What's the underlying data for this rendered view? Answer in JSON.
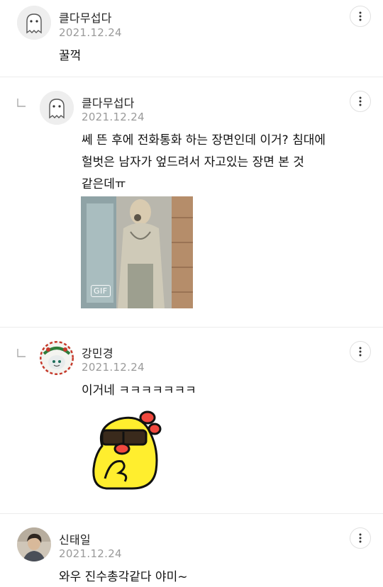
{
  "comments": [
    {
      "author": "클다무섭다",
      "date": "2021.12.24",
      "body": "꿀꺽",
      "avatar": "ghost-avatar",
      "is_reply": false
    },
    {
      "author": "클다무섭다",
      "date": "2021.12.24",
      "body_lines": [
        "쎄 뜬 후에 전화통화 하는 장면인데 이거? 침대에",
        "헐벗은 남자가 엎드려서 자고있는 장면 본 것",
        "같은데ㅠ"
      ],
      "avatar": "ghost-avatar",
      "is_reply": true,
      "attachment": {
        "type": "gif",
        "badge": "GIF"
      }
    },
    {
      "author": "강민경",
      "date": "2021.12.24",
      "body": "이거네 ㅋㅋㅋㅋㅋㅋㅋ",
      "avatar": "christmas-avatar",
      "is_reply": true,
      "attachment": {
        "type": "sticker",
        "icon": "sunglasses-chick-sticker"
      }
    },
    {
      "author": "신태일",
      "date": "2021.12.24",
      "body": "와우 진수총각같다 야미~",
      "avatar": "photo-avatar",
      "is_reply": false
    }
  ],
  "icons": {
    "more": "more-vertical-icon",
    "reply": "reply-arrow-icon"
  },
  "colors": {
    "date": "#9a9a9a",
    "divider": "#ececec",
    "sticker_yellow": "#ffee2e",
    "sticker_red": "#f0483e"
  }
}
